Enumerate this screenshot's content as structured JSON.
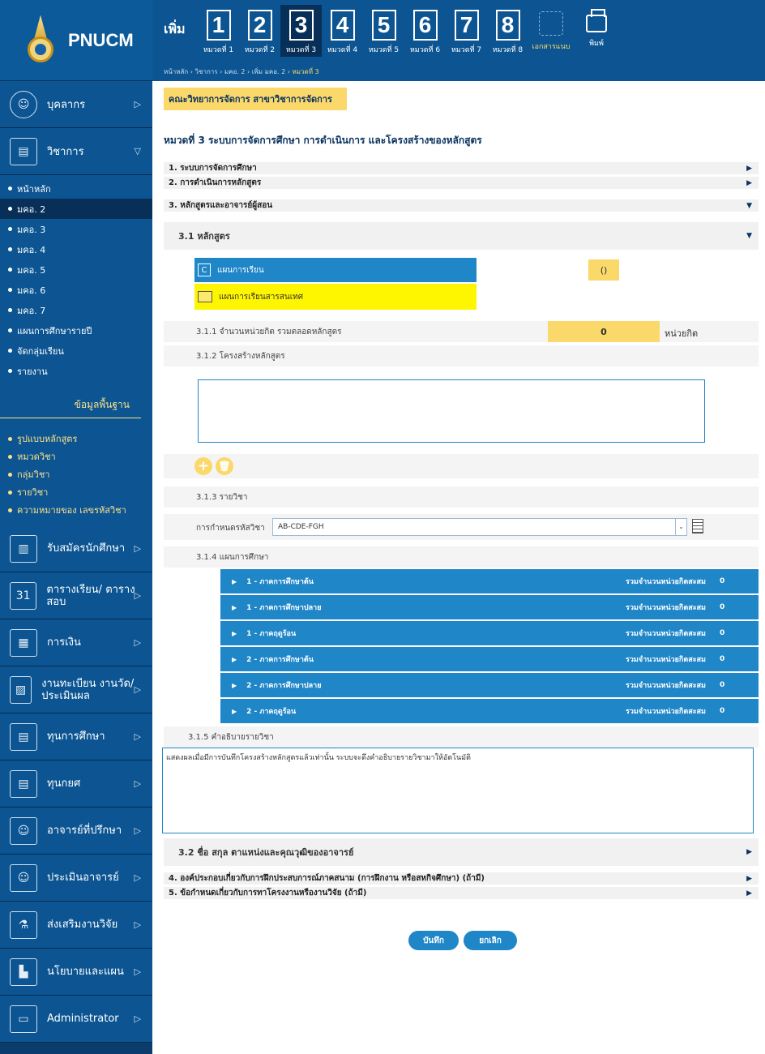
{
  "app": {
    "name": "PNUCM"
  },
  "sidebar": {
    "menu": [
      {
        "label": "บุคลากร",
        "icon": "person-icon"
      },
      {
        "label": "วิชาการ",
        "icon": "book-icon"
      }
    ],
    "academic_items": [
      "หน้าหลัก",
      "มคอ. 2",
      "มคอ. 3",
      "มคอ. 4",
      "มคอ. 5",
      "มคอ. 6",
      "มคอ. 7",
      "แผนการศึกษารายปี",
      "จัดกลุ่มเรียน",
      "รายงาน"
    ],
    "basic_data_header": "ข้อมูลพื้นฐาน",
    "basic_data_items": [
      "รูปแบบหลักสูตร",
      "หมวดวิชา",
      "กลุ่มวิชา",
      "รายวิชา",
      "ความหมายของ เลขรหัสวิชา"
    ],
    "modules": [
      {
        "label": "รับสมัครนักศึกษา",
        "icon": "notebook-icon"
      },
      {
        "label": "ตารางเรียน/ ตารางสอบ",
        "icon": "calendar-icon"
      },
      {
        "label": "การเงิน",
        "icon": "money-icon"
      },
      {
        "label": "งานทะเบียน งานวัด/ประเมินผล",
        "icon": "chart-icon"
      },
      {
        "label": "ทุนการศึกษา",
        "icon": "scholarship-icon"
      },
      {
        "label": "ทุนกยศ",
        "icon": "loan-icon"
      },
      {
        "label": "อาจารย์ที่ปรึกษา",
        "icon": "advisor-icon"
      },
      {
        "label": "ประเมินอาจารย์",
        "icon": "evaluate-icon"
      },
      {
        "label": "ส่งเสริมงานวิจัย",
        "icon": "flask-icon"
      },
      {
        "label": "นโยบายและแผน",
        "icon": "policy-icon"
      },
      {
        "label": "Administrator",
        "icon": "monitor-icon"
      }
    ]
  },
  "topbar": {
    "add_label": "เพิ่ม",
    "steps": [
      {
        "num": "1",
        "label": "หมวดที่ 1"
      },
      {
        "num": "2",
        "label": "หมวดที่ 2"
      },
      {
        "num": "3",
        "label": "หมวดที่ 3"
      },
      {
        "num": "4",
        "label": "หมวดที่ 4"
      },
      {
        "num": "5",
        "label": "หมวดที่ 5"
      },
      {
        "num": "6",
        "label": "หมวดที่ 6"
      },
      {
        "num": "7",
        "label": "หมวดที่ 7"
      },
      {
        "num": "8",
        "label": "หมวดที่ 8"
      }
    ],
    "doc_label": "เอกสารแนบ",
    "print_label": "พิมพ์",
    "breadcrumb": "หน้าหลัก › วิชาการ › มคอ. 2 › เพิ่ม มคอ. 2 ›",
    "breadcrumb_current": "หมวดที่ 3"
  },
  "main": {
    "faculty": "คณะวิทยาการจัดการ สาขาวิชาการจัดการ",
    "title": "หมวดที่ 3 ระบบการจัดการศึกษา การดำเนินการ และโครงสร้างของหลักสูตร",
    "sections": [
      "1. ระบบการจัดการศึกษา",
      "2. การดำเนินการหลักสูตร",
      "3. หลักสูตรและอาจารย์ผู้สอน"
    ],
    "sub_3_1": "3.1 หลักสูตร",
    "plan_blue": "แผนการเรียน",
    "plan_blue_value": "()",
    "plan_yellow": "แผนการเรียนสารสนเทศ",
    "credits_label": "3.1.1 จำนวนหน่วยกิต รวมตลอดหลักสูตร",
    "credits_value": "0",
    "credits_unit": "หน่วยกิต",
    "structure_label": "3.1.2 โครงสร้างหลักสูตร",
    "courses_label": "3.1.3 รายวิชา",
    "code_label": "การกำหนดรหัสวิชา",
    "code_value": "AB-CDE-FGH",
    "study_plan_label": "3.1.4 แผนการศึกษา",
    "terms": [
      {
        "label": "1 - ภาคการศึกษาต้น",
        "acc_label": "รวมจำนวนหน่วยกิตสะสม",
        "acc_value": "0"
      },
      {
        "label": "1 - ภาคการศึกษาปลาย",
        "acc_label": "รวมจำนวนหน่วยกิตสะสม",
        "acc_value": "0"
      },
      {
        "label": "1 - ภาคฤดูร้อน",
        "acc_label": "รวมจำนวนหน่วยกิตสะสม",
        "acc_value": "0"
      },
      {
        "label": "2 - ภาคการศึกษาต้น",
        "acc_label": "รวมจำนวนหน่วยกิตสะสม",
        "acc_value": "0"
      },
      {
        "label": "2 - ภาคการศึกษาปลาย",
        "acc_label": "รวมจำนวนหน่วยกิตสะสม",
        "acc_value": "0"
      },
      {
        "label": "2 - ภาคฤดูร้อน",
        "acc_label": "รวมจำนวนหน่วยกิตสะสม",
        "acc_value": "0"
      }
    ],
    "desc_label": "3.1.5 คำอธิบายรายวิชา",
    "desc_text": "แสดงผลเมื่อมีการบันทึกโครงสร้างหลักสูตรแล้วเท่านั้น ระบบจะดึงคำอธิบายรายวิชามาให้อัตโนมัติ",
    "sub_3_2": "3.2 ชื่อ สกุล ตาแหน่งและคุณวุฒิของอาจารย์",
    "sections_after": [
      "4. องค์ประกอบเกี่ยวกับการฝึกประสบการณ์ภาคสนาม (การฝึกงาน หรือสหกิจศึกษา) (ถ้ามี)",
      "5. ข้อกำหนดเกี่ยวกับการทาโครงงานหรืองานวิจัย (ถ้ามี)"
    ],
    "save_label": "บันทึก",
    "cancel_label": "ยกเลิก"
  },
  "colors": {
    "brand": "#0c5592",
    "accent": "#fbd86a",
    "highlight": "#fef600",
    "panel": "#1f86c8"
  }
}
